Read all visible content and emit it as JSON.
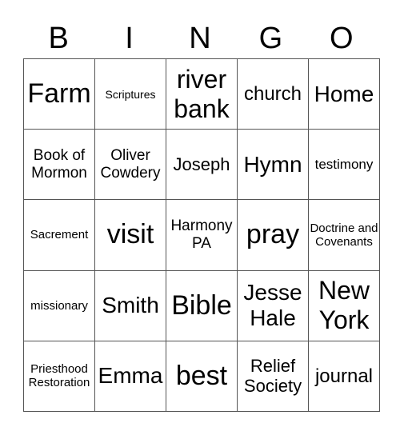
{
  "header": {
    "letters": [
      "B",
      "I",
      "N",
      "G",
      "O"
    ]
  },
  "board": {
    "rows": [
      [
        "Farm",
        "Scriptures",
        "river bank",
        "church",
        "Home"
      ],
      [
        "Book of Mormon",
        "Oliver Cowdery",
        "Joseph",
        "Hymn",
        "testimony"
      ],
      [
        "Sacrement",
        "visit",
        "Harmony PA",
        "pray",
        "Doctrine and Covenants"
      ],
      [
        "missionary",
        "Smith",
        "Bible",
        "Jesse Hale",
        "New York"
      ],
      [
        "Priesthood Restoration",
        "Emma",
        "best",
        "Relief Society",
        "journal"
      ]
    ]
  },
  "colors": {
    "grid_line": "#555555",
    "text": "#000000",
    "background": "#ffffff"
  }
}
